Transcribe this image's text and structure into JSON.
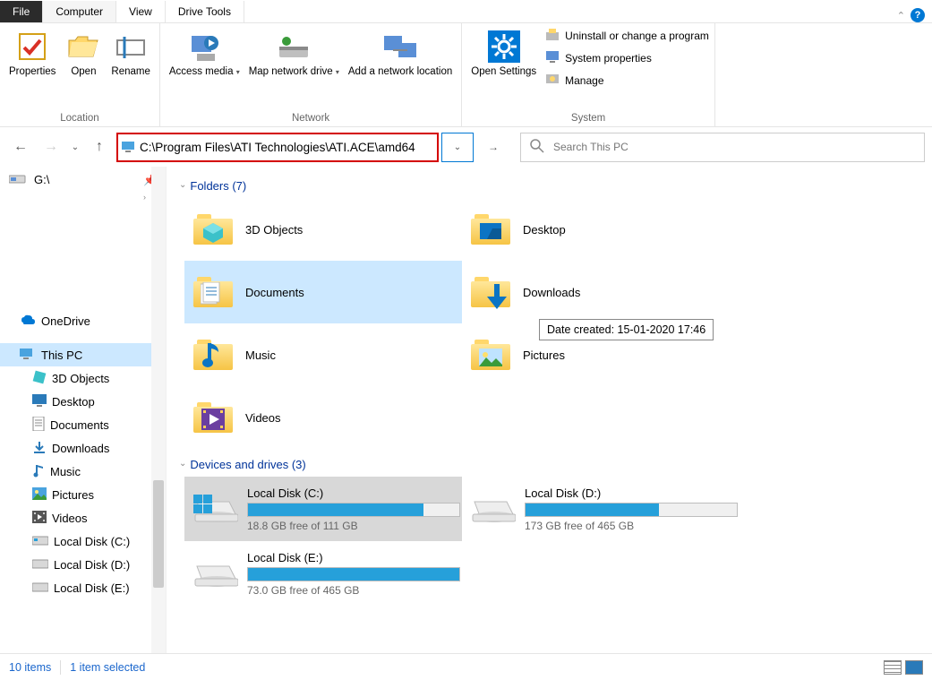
{
  "tabs": {
    "file": "File",
    "computer": "Computer",
    "view": "View",
    "drive_tools": "Drive Tools"
  },
  "ribbon": {
    "location": {
      "label": "Location",
      "properties": "Properties",
      "open": "Open",
      "rename": "Rename"
    },
    "network": {
      "label": "Network",
      "access_media": "Access media",
      "map_drive": "Map network drive",
      "add_loc": "Add a network location"
    },
    "system": {
      "label": "System",
      "open_settings": "Open Settings",
      "uninstall": "Uninstall or change a program",
      "props": "System properties",
      "manage": "Manage"
    }
  },
  "address": {
    "value": "C:\\Program Files\\ATI Technologies\\ATI.ACE\\amd64"
  },
  "search": {
    "placeholder": "Search This PC"
  },
  "sidebar": {
    "drive_top": "G:\\",
    "onedrive": "OneDrive",
    "thispc": "This PC",
    "items": [
      "3D Objects",
      "Desktop",
      "Documents",
      "Downloads",
      "Music",
      "Pictures",
      "Videos",
      "Local Disk (C:)",
      "Local Disk (D:)",
      "Local Disk (E:)"
    ]
  },
  "sections": {
    "folders": "Folders (7)",
    "drives": "Devices and drives (3)"
  },
  "folders": [
    "3D Objects",
    "Desktop",
    "Documents",
    "Downloads",
    "Music",
    "Pictures",
    "Videos"
  ],
  "tooltip": "Date created: 15-01-2020 17:46",
  "drives": [
    {
      "name": "Local Disk (C:)",
      "free": "18.8 GB free of 111 GB",
      "pct": 83
    },
    {
      "name": "Local Disk (D:)",
      "free": "173 GB free of 465 GB",
      "pct": 63
    },
    {
      "name": "Local Disk (E:)",
      "free": "73.0 GB free of 465 GB",
      "pct": 100
    }
  ],
  "status": {
    "count": "10 items",
    "selected": "1 item selected"
  }
}
